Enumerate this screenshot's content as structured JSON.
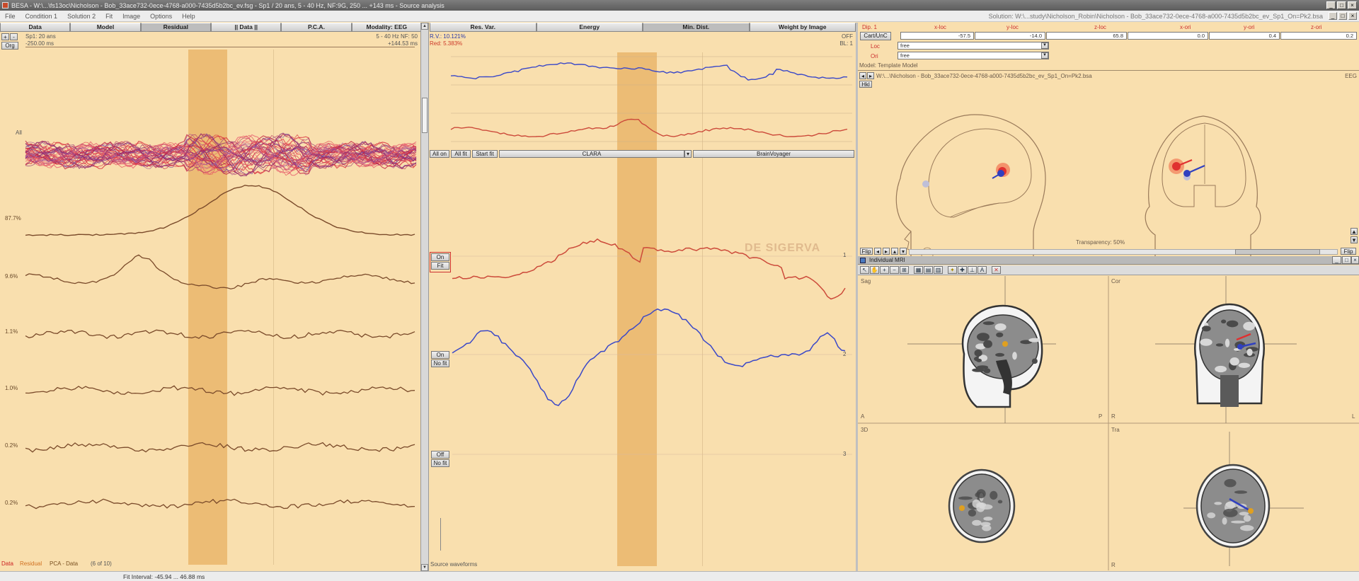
{
  "app": {
    "title": "BESA - W:\\...\\fs13oc\\Nicholson - Bob_33ace732-0ece-4768-a000-7435d5b2bc_ev.fsg - Sp1 / 20 ans, 5 - 40 Hz, NF:9G, 250 ... +143 ms - Source analysis",
    "solution": "Solution: W:\\...study\\Nicholson_Robin\\Nicholson - Bob_33ace732-0ece-4768-a000-7435d5b2bc_ev_Sp1_On=Pk2.bsa",
    "window_controls": [
      "_",
      "□",
      "×"
    ]
  },
  "menu": [
    "File",
    "Condition 1",
    "Solution 2",
    "Fit",
    "Image",
    "Options",
    "Help"
  ],
  "left": {
    "tabs": [
      "Data",
      "Model",
      "Residual",
      "|| Data ||",
      "P.C.A.",
      "Modality: EEG"
    ],
    "info_left": [
      "Sp1: 20 ans",
      "-250.00 ms"
    ],
    "info_right": [
      "5 - 40 Hz  NF: 50",
      "+144.53 ms"
    ],
    "org_label": "Org",
    "all_label": "All",
    "trace_labels": [
      "87.7%",
      "9.6%",
      "1.1%",
      "1.0%",
      "0.2%",
      "0.2%"
    ],
    "legend": [
      {
        "text": "Data",
        "color": "#cc2020"
      },
      {
        "text": "Residual",
        "color": "#d07020"
      },
      {
        "text": "PCA - Data",
        "color": "#7a5020"
      },
      {
        "text": "(6 of 10)",
        "color": "#555555"
      }
    ]
  },
  "middle": {
    "tabs": [
      "Res. Var.",
      "Energy",
      "Min. Dist.",
      "Weight by Image"
    ],
    "rv": "R.V.: 10.121%",
    "red": "Red: 5.383%",
    "off": "OFF",
    "bl": "BL: 1",
    "toolbar": {
      "all_on": "All on",
      "all_fit": "All fit",
      "start_fit": "Start fit",
      "method": "CLARA",
      "brain": "BrainVoyager"
    },
    "sources": [
      {
        "num": "1",
        "btn1": "On",
        "btn2": "Fit"
      },
      {
        "num": "2",
        "btn1": "On",
        "btn2": "No fit"
      },
      {
        "num": "3",
        "btn1": "Off",
        "btn2": "No fit"
      }
    ],
    "footer": "Source waveforms",
    "watermark": "DE SIGERVA"
  },
  "right": {
    "dip_label": "Dip. 1",
    "cols": [
      "x-loc",
      "y-loc",
      "z-loc",
      "x-ori",
      "y-ori",
      "z-ori"
    ],
    "cart_btn": "Cart/UnC",
    "values": [
      "-57.5",
      "-14.0",
      "65.8",
      "0.0",
      "0.4",
      "0.2"
    ],
    "loc_label": "Loc",
    "ori_label": "Ori",
    "loc_value": "free",
    "ori_value": "free",
    "model_label": "Model: Template Model",
    "head_path": "W:\\...\\Nicholson - Bob_33ace732-0ece-4768-a000-7435d5b2bc_ev_Sp1_On=Pk2.bsa",
    "eeg_label": "EEG",
    "hkl_label": "Hkl",
    "transparency": "Transparency: 50%",
    "flip_label": "Flip",
    "mri_title": "Individual MRI",
    "views": [
      {
        "name": "Sag",
        "corner_l": "A",
        "corner_r": "P"
      },
      {
        "name": "Cor",
        "corner_l": "R",
        "corner_r": "L"
      },
      {
        "name": "3D",
        "corner_l": "",
        "corner_r": ""
      },
      {
        "name": "Tra",
        "corner_l": "R",
        "corner_r": ""
      }
    ]
  },
  "status": {
    "fit_interval": "Fit Interval: -45.94 ... 46.88 ms"
  },
  "colors": {
    "bg": "#f9dfae",
    "highlight": "#eab66b",
    "blue": "#3a48c8",
    "red": "#cc4a3a",
    "trace": "#7a4a2a"
  }
}
